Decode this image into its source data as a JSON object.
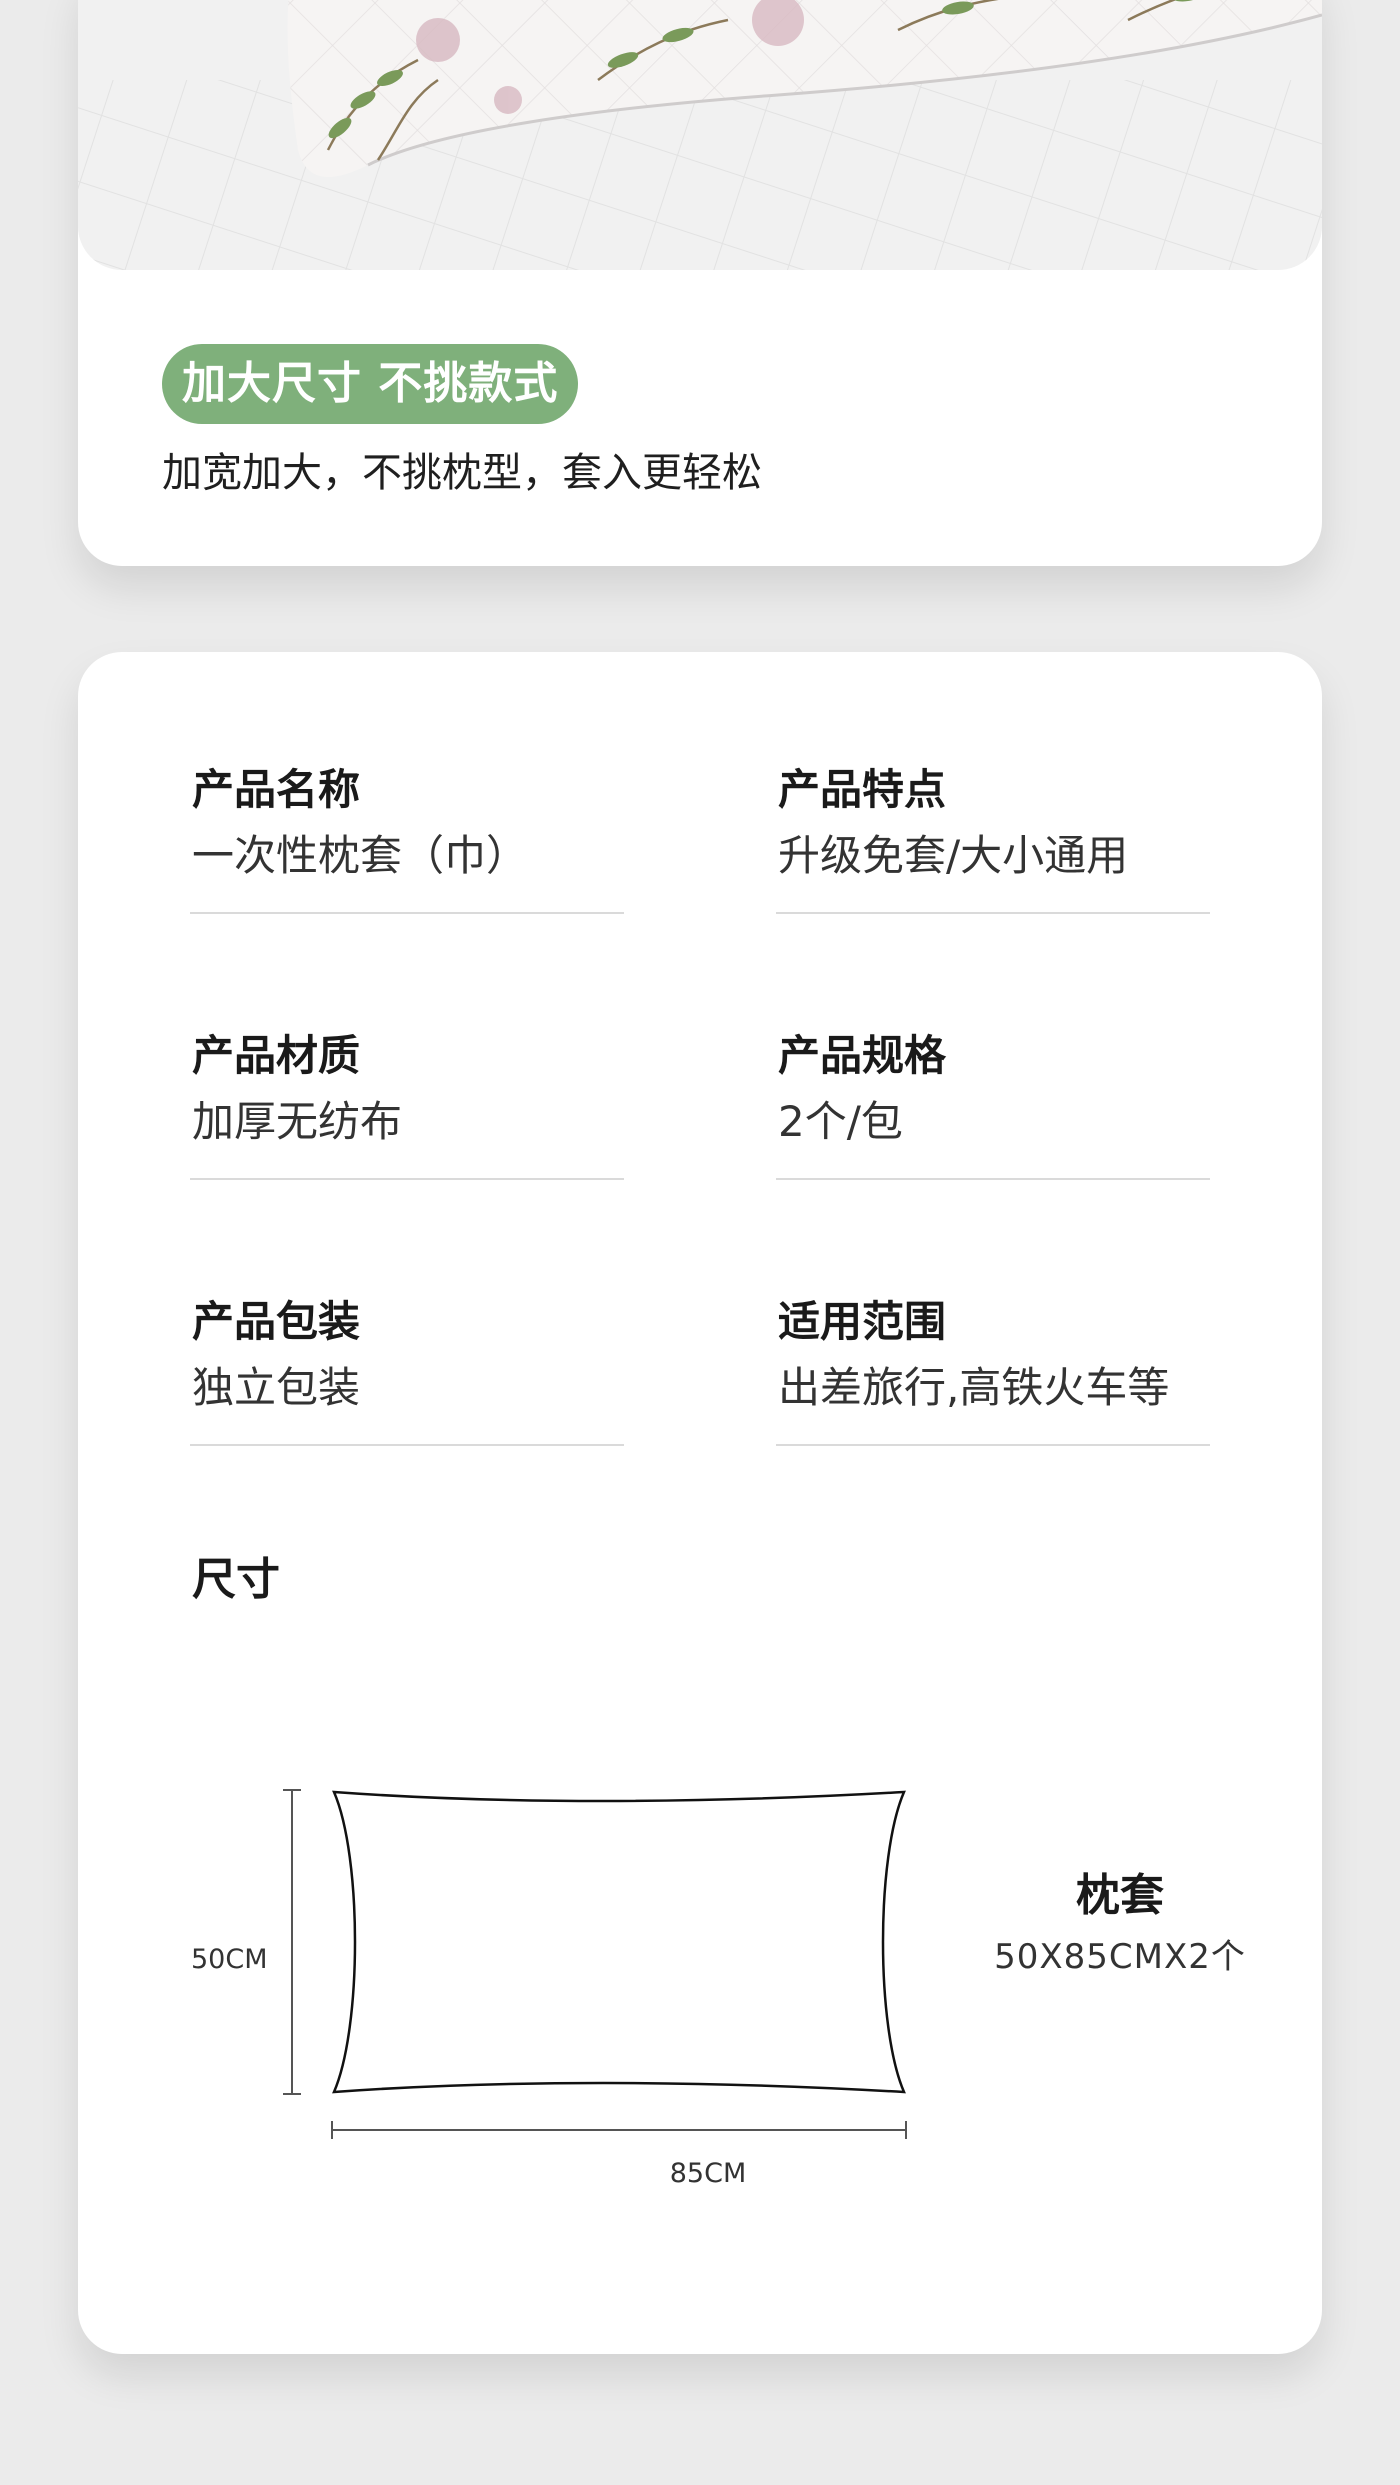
{
  "banner": {
    "tag": "加大尺寸 不挑款式",
    "description": "加宽加大，不挑枕型，套入更轻松"
  },
  "specs": [
    {
      "label": "产品名称",
      "value": "一次性枕套（巾）"
    },
    {
      "label": "产品特点",
      "value": "升级免套/大小通用"
    },
    {
      "label": "产品材质",
      "value": "加厚无纺布"
    },
    {
      "label": "产品规格",
      "value": "2个/包"
    },
    {
      "label": "产品包装",
      "value": "独立包装"
    },
    {
      "label": "适用范围",
      "value": "出差旅行,高铁火车等"
    }
  ],
  "size": {
    "title": "尺寸",
    "height_label": "50CM",
    "width_label": "85CM",
    "product_name": "枕套",
    "product_spec": "50X85CMX2个"
  },
  "colors": {
    "accent": "#7fb07b",
    "card": "#ffffff",
    "background": "#ebebeb"
  }
}
